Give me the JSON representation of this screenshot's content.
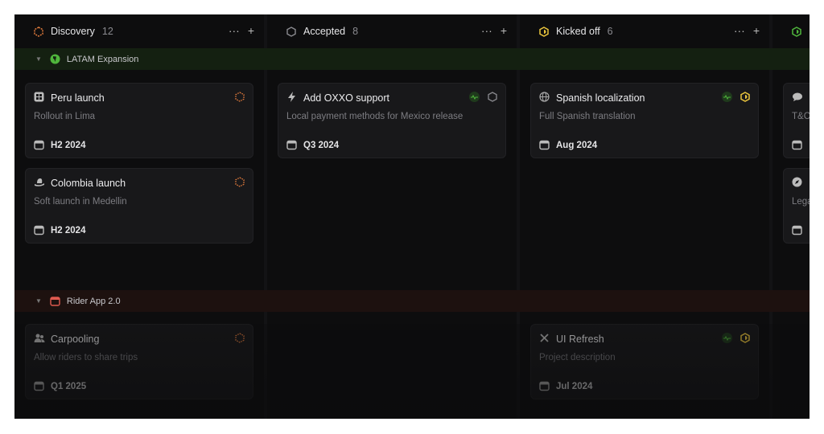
{
  "columns": [
    {
      "title": "Discovery",
      "count": "12",
      "status_icon": "hexagon-dashed-icon",
      "color": "#e07a3c"
    },
    {
      "title": "Accepted",
      "count": "8",
      "status_icon": "hexagon-icon",
      "color": "#8a8a8f"
    },
    {
      "title": "Kicked off",
      "count": "6",
      "status_icon": "hexagon-half-icon",
      "color": "#e8c33c"
    },
    {
      "title": "",
      "count": "",
      "status_icon": "hexagon-half-icon",
      "color": "#4fb53c"
    }
  ],
  "column_actions": {
    "more": "···",
    "add": "+"
  },
  "groups": [
    {
      "name": "LATAM Expansion",
      "icon": "globe-americas-icon",
      "color": "#4fb53c"
    },
    {
      "name": "Rider App 2.0",
      "icon": "app-window-icon",
      "color": "#e05a4f"
    }
  ],
  "cards": {
    "peru": {
      "title": "Peru launch",
      "desc": "Rollout in Lima",
      "date": "H2 2024",
      "icon": "grid-icon"
    },
    "colombia": {
      "title": "Colombia launch",
      "desc": "Soft launch in Medellin",
      "date": "H2 2024",
      "icon": "hat-icon"
    },
    "oxxo": {
      "title": "Add OXXO support",
      "desc": "Local payment methods for Mexico release",
      "date": "Q3 2024",
      "icon": "lightning-icon"
    },
    "spanish": {
      "title": "Spanish localization",
      "desc": "Full Spanish translation",
      "date": "Aug 2024",
      "icon": "globe-icon"
    },
    "tc": {
      "title": "",
      "desc": "T&C",
      "date": "",
      "icon": "chat-bubble-icon"
    },
    "legal": {
      "title": "",
      "desc": "Lega",
      "date": "",
      "icon": "compass-icon"
    },
    "carpooling": {
      "title": "Carpooling",
      "desc": "Allow riders to share trips",
      "date": "Q1 2025",
      "icon": "users-icon"
    },
    "uirefresh": {
      "title": "UI Refresh",
      "desc": "Project description",
      "date": "Jul 2024",
      "icon": "tools-icon"
    }
  }
}
